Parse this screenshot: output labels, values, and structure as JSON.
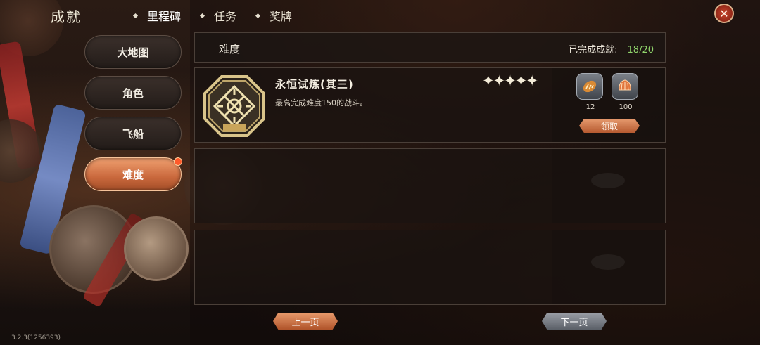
{
  "header": {
    "title": "成就",
    "tabs": [
      {
        "label": "里程碑",
        "active": true
      },
      {
        "label": "任务",
        "active": false
      },
      {
        "label": "奖牌",
        "active": false
      }
    ],
    "close_icon": "close-icon"
  },
  "sidebar": {
    "items": [
      {
        "label": "大地图",
        "active": false
      },
      {
        "label": "角色",
        "active": false
      },
      {
        "label": "飞船",
        "active": false
      },
      {
        "label": "难度",
        "active": true,
        "has_notification": true
      }
    ]
  },
  "panel": {
    "category_title": "难度",
    "progress_label": "已完成成就:",
    "progress_value": "18/20"
  },
  "achievements": [
    {
      "name": "永恒试炼(其三)",
      "description": "最高完成难度150的战斗。",
      "stars": "✦✦✦✦✦",
      "star_count": 5,
      "medal_icon": "knot-medal-icon",
      "rewards": [
        {
          "icon": "bread-icon",
          "qty": "12"
        },
        {
          "icon": "shell-icon",
          "qty": "100"
        }
      ],
      "claim_label": "领取"
    }
  ],
  "pager": {
    "prev_label": "上一页",
    "next_label": "下一页"
  },
  "footer": {
    "version": "3.2.3(1256393)"
  },
  "colors": {
    "accent_orange": "#c9683c",
    "progress_green": "#8fd36b",
    "panel_border": "#4a3f38"
  }
}
